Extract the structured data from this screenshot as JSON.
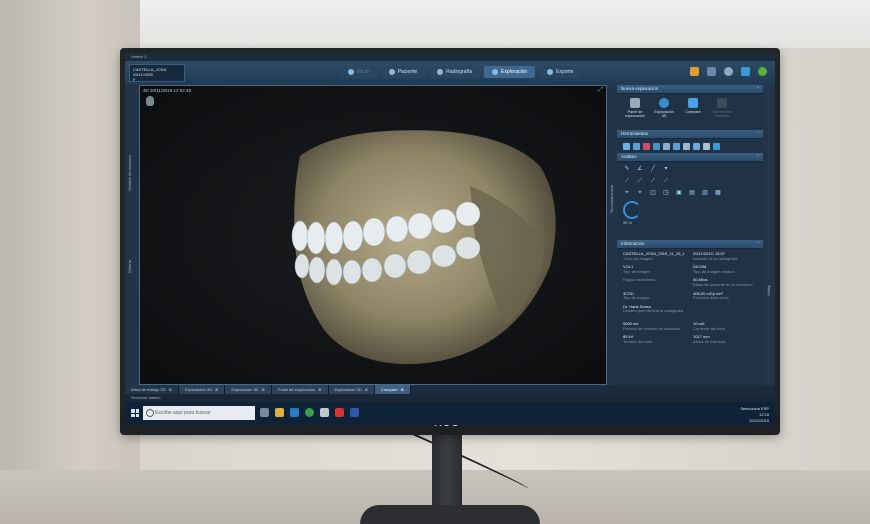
{
  "window": {
    "title": "Vatech 3"
  },
  "patient": {
    "name": "CASTELLA_JOSA",
    "id": "25/11/1955",
    "extra": "F"
  },
  "nav_tabs": [
    {
      "label": "Inicio",
      "state": "disabled"
    },
    {
      "label": "Paciente",
      "state": "normal"
    },
    {
      "label": "Radiografía",
      "state": "normal"
    },
    {
      "label": "Exploración",
      "state": "active"
    },
    {
      "label": "Exporte",
      "state": "normal"
    }
  ],
  "viewport": {
    "label": "3D 20/11/2019 12:02:49"
  },
  "left_rail": {
    "label1": "Gestión de recursos",
    "label2": "Galería"
  },
  "mid_rail": {
    "label": "Reconstrucción"
  },
  "right_rail": {
    "label": "Multip"
  },
  "panel": {
    "nueva_exploracion": {
      "header": "Nueva exploración",
      "buttons": [
        {
          "label": "Panel de exploración",
          "icon": "panel-icon",
          "disabled": false
        },
        {
          "label": "Exploración 3D",
          "icon": "3d-icon",
          "disabled": false
        },
        {
          "label": "Compare",
          "icon": "compare-icon",
          "disabled": false
        },
        {
          "label": "Información Paciente",
          "icon": "info-icon",
          "disabled": true
        }
      ]
    },
    "herramientas": {
      "header": "Herramientas"
    },
    "analisis": {
      "header": "Análisis",
      "gauge_value": "90 %"
    },
    "informacion": {
      "header": "Información",
      "rows": [
        [
          {
            "value": "CASTELLA_JOSA_2019_11_20_1",
            "key": "Título de imagen"
          },
          {
            "value": "20/11/2019, 13:57",
            "key": "Instante de la radiografía"
          }
        ],
        [
          {
            "value": "VOL1",
            "key": "Tipo de imagen"
          },
          {
            "value": "DICOM",
            "key": "Tipo de imagen médica"
          }
        ],
        [
          {
            "value": "",
            "key": "Región anatómica"
          },
          {
            "value": "50 Años",
            "key": "Edad del paciente en el momento"
          }
        ],
        [
          {
            "value": "3CSD",
            "key": "Tipo de equipo"
          },
          {
            "value": "405,00 mGy·cm²",
            "key": "Producto área dosis"
          }
        ],
        [
          {
            "value": "Dr. Hans Dusso",
            "key": "Usuario que efectúa la radiografía"
          },
          {
            "value": "",
            "key": ""
          }
        ],
        [
          {
            "value": "5000 ms",
            "key": "Periodo de emisión de radiación"
          },
          {
            "value": "10 mA",
            "key": "Corriente del tubo"
          }
        ],
        [
          {
            "value": "85 kV",
            "key": "Tensión del tubo"
          },
          {
            "value": "1017 mm",
            "key": "Altura de escritura"
          }
        ]
      ]
    }
  },
  "doc_tabs": [
    {
      "label": "Árbol de trabajo 2D",
      "active": false,
      "first": true
    },
    {
      "label": "Exploración 3D",
      "active": false
    },
    {
      "label": "Exploración 3D",
      "active": false
    },
    {
      "label": "Panel de exploración",
      "active": false
    },
    {
      "label": "Exploración 3D",
      "active": false
    },
    {
      "label": "Compare",
      "active": true
    }
  ],
  "statusbar": {
    "text": "Servicios Vatech"
  },
  "taskbar": {
    "search_placeholder": "Escribe aquí para buscar",
    "tray_top": "Selecciona ESP",
    "time": "12:18",
    "date": "20/11/2019"
  },
  "monitor": {
    "brand": "AOC"
  }
}
